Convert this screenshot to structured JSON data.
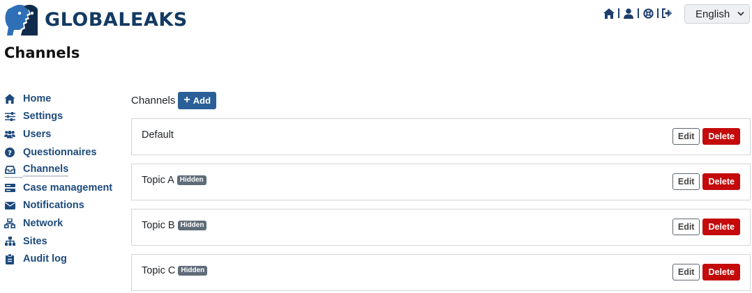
{
  "brand": {
    "name": "GLOBALEAKS",
    "logo_icon": "globaleaks-faces-logo"
  },
  "topnav": {
    "icons": [
      "home-icon",
      "user-icon",
      "support-icon",
      "logout-icon"
    ]
  },
  "language": {
    "selected": "English"
  },
  "page": {
    "title": "Channels"
  },
  "sidebar": {
    "items": [
      {
        "label": "Home",
        "icon": "home-icon"
      },
      {
        "label": "Settings",
        "icon": "sliders-icon"
      },
      {
        "label": "Users",
        "icon": "users-icon"
      },
      {
        "label": "Questionnaires",
        "icon": "question-circle-icon"
      },
      {
        "label": "Channels",
        "icon": "inbox-icon",
        "active": true
      },
      {
        "label": "Case management",
        "icon": "server-icon"
      },
      {
        "label": "Notifications",
        "icon": "envelope-icon"
      },
      {
        "label": "Network",
        "icon": "network-icon"
      },
      {
        "label": "Sites",
        "icon": "sitemap-icon"
      },
      {
        "label": "Audit log",
        "icon": "clipboard-icon"
      }
    ]
  },
  "main": {
    "header_label": "Channels",
    "add_label": "Add",
    "channels": [
      {
        "name": "Default",
        "badge": ""
      },
      {
        "name": "Topic A",
        "badge": "Hidden"
      },
      {
        "name": "Topic B",
        "badge": "Hidden"
      },
      {
        "name": "Topic C",
        "badge": "Hidden"
      }
    ],
    "edit_label": "Edit",
    "delete_label": "Delete"
  },
  "colors": {
    "nav_text": "#1d4a7c",
    "primary_button": "#2a5f97",
    "danger_button": "#c40a0a",
    "badge": "#5f6b78"
  }
}
